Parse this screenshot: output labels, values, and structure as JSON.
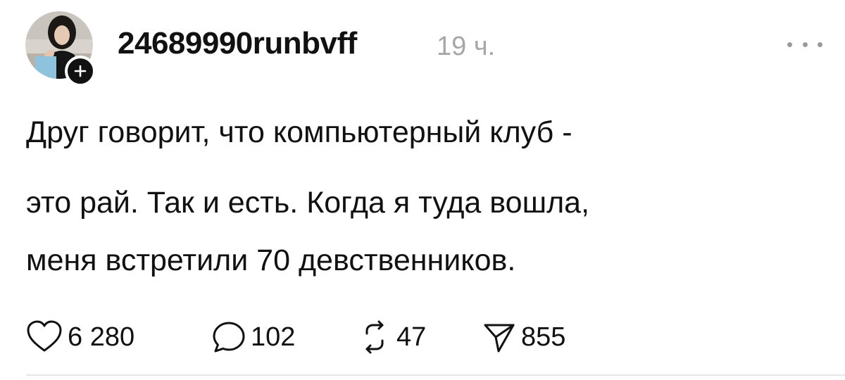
{
  "post": {
    "username": "24689990runbvff",
    "time": "19 ч.",
    "text_lines": [
      "Друг говорит, что компьютерный клуб -",
      "это рай. Так и есть. Когда я туда вошла,",
      "меня встретили 70 девственников."
    ]
  },
  "actions": {
    "likes": "6 280",
    "replies": "102",
    "reposts": "47",
    "shares": "855"
  },
  "icons": {
    "avatar": "avatar",
    "follow": "plus-icon",
    "more": "more-icon",
    "like": "heart-icon",
    "reply": "comment-icon",
    "repost": "repost-icon",
    "share": "send-icon"
  },
  "colors": {
    "text": "#111111",
    "muted": "#a7a7a7",
    "divider": "#e6e6e6"
  }
}
